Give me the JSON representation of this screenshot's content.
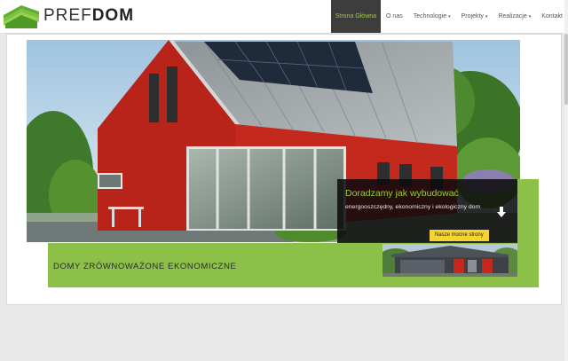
{
  "brand": {
    "name_light": "PREF",
    "name_bold": "DOM"
  },
  "nav": {
    "items": [
      {
        "label": "Strona Główna",
        "active": true,
        "has_dropdown": false
      },
      {
        "label": "O nas",
        "active": false,
        "has_dropdown": false
      },
      {
        "label": "Technologie",
        "active": false,
        "has_dropdown": true
      },
      {
        "label": "Projekty",
        "active": false,
        "has_dropdown": true
      },
      {
        "label": "Realizacje",
        "active": false,
        "has_dropdown": true
      },
      {
        "label": "Kontakt",
        "active": false,
        "has_dropdown": false
      }
    ],
    "caret": "▾"
  },
  "hero": {
    "overlay_heading": "Doradzamy jak wybudować",
    "overlay_text": "energooszczędny, ekonomiczny i ekologiczny dom",
    "cta_label": "Nasze mocne strony",
    "band_title": "DOMY  ZRÓWNOWAŻONE  EKONOMICZNE"
  },
  "colors": {
    "accent_green": "#8cc048",
    "nav_active_bg": "#3d3d3d",
    "nav_active_text": "#9bd12d",
    "cta_yellow": "#f5d431",
    "house_red": "#c0281f"
  },
  "icons": {
    "logo": "house-logo-icon",
    "down_arrow": "arrow-down-icon"
  }
}
